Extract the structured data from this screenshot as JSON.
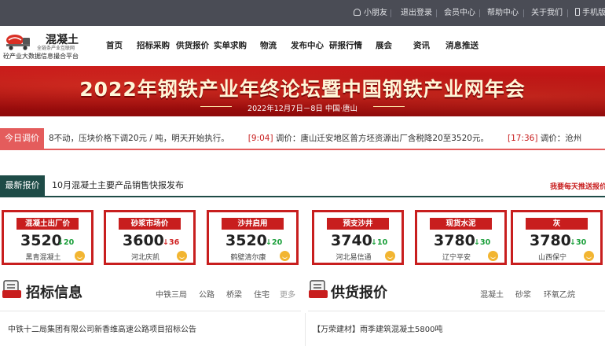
{
  "topbar": {
    "user": "小朋友",
    "logout": "退出登录",
    "member_center": "会员中心",
    "help_center": "帮助中心",
    "about": "关于我们",
    "mobile": "手机版"
  },
  "logo": {
    "title": "混凝土",
    "subtitle": "全链条产业互联网",
    "slogan": "砼产业大数据信息撮合平台"
  },
  "nav": [
    "首页",
    "招标采购",
    "供货报价",
    "实单求购",
    "物流",
    "发布中心",
    "研报行情",
    "展会",
    "资讯",
    "消息推送"
  ],
  "banner": {
    "title": "2022年钢铁产业年终论坛暨中国钢铁产业网年会",
    "date": "2022年12月7日－8日  中国·唐山"
  },
  "today": {
    "label": "今日调价",
    "lead": "8不动，压块价格下调20元 / 吨，明天开始执行。",
    "items": [
      {
        "time": "[9:04]",
        "text": " 调价：唐山迁安地区普方坯资源出厂含税降20至3520元。"
      },
      {
        "time": "[17:36]",
        "text": " 调价：沧州"
      }
    ]
  },
  "latest": {
    "label": "最新报价",
    "text": "10月混凝土主要产品销售快报发布",
    "link": "我要每天推送报价"
  },
  "cards": [
    {
      "title": "混凝土出厂价",
      "value": "3520",
      "change": "↓20",
      "dir": "up",
      "place": "黑青混凝土"
    },
    {
      "title": "砂浆市场价",
      "value": "3600",
      "change": "↓36",
      "dir": "down",
      "place": "河北庆凯"
    },
    {
      "title": "沙井启用",
      "value": "3520",
      "change": "↓20",
      "dir": "up",
      "place": "鹤壁清尔康"
    },
    {
      "title": "预支沙井",
      "value": "3740",
      "change": "↓10",
      "dir": "up",
      "place": "河北易信通"
    },
    {
      "title": "现货水泥",
      "value": "3780",
      "change": "↓30",
      "dir": "up",
      "place": "辽宁平安"
    },
    {
      "title": "灰",
      "value": "3780",
      "change": "↓30",
      "dir": "up",
      "place": "山西保宁"
    }
  ],
  "colors": {
    "accent_red": "#c81e1e",
    "dark_green": "#1e4b47",
    "rise_green": "#1a9f3a",
    "topbar": "#4a4c55"
  },
  "tender": {
    "title": "招标信息",
    "tabs": [
      "中铁三局",
      "公路",
      "桥梁",
      "住宅"
    ],
    "more": "更多",
    "items": [
      "中铁十二局集团有限公司新香维高速公路项目招标公告"
    ]
  },
  "supply": {
    "title": "供货报价",
    "tabs": [
      "混凝土",
      "砂浆",
      "环氧乙烷"
    ],
    "items": [
      "【万荣建材】雨季建筑混凝土5800吨"
    ]
  },
  "icons": [
    "user-icon",
    "phone-icon",
    "truck-logo-icon",
    "smile-icon",
    "document-icon"
  ]
}
